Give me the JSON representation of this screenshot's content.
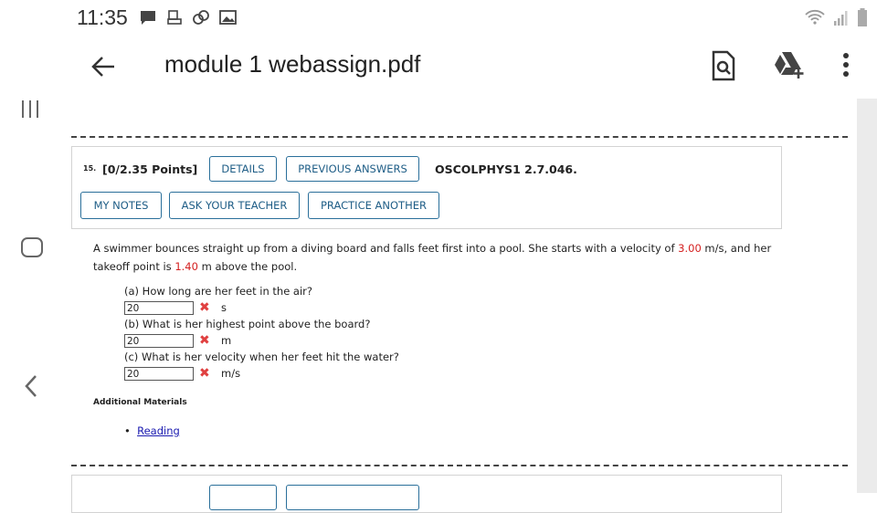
{
  "status_bar": {
    "time": "11:35"
  },
  "app_bar": {
    "title": "module 1 webassign.pdf",
    "icons": [
      "back-arrow-icon",
      "search-in-document-icon",
      "drive-add-icon",
      "more-vert-icon"
    ]
  },
  "question": {
    "number": "15.",
    "points": "[0/2.35 Points]",
    "buttons": {
      "details": "DETAILS",
      "previous_answers": "PREVIOUS ANSWERS",
      "my_notes": "MY NOTES",
      "ask_teacher": "ASK YOUR TEACHER",
      "practice_another": "PRACTICE ANOTHER"
    },
    "code": "OSCOLPHYS1 2.7.046.",
    "problem": {
      "p1": "A swimmer bounces straight up from a diving board and falls feet first into a pool. She starts with a velocity of ",
      "v": "3.00",
      "p2": " m/s, and her",
      "p3": "takeoff point is ",
      "h": "1.40",
      "p4": " m above the pool."
    },
    "parts": [
      {
        "question": "(a) How long are her feet in the air?",
        "answer": "20",
        "unit": "s"
      },
      {
        "question": "(b) What is her highest point above the board?",
        "answer": "20",
        "unit": "m"
      },
      {
        "question": "(c) What is her velocity when her feet hit the water?",
        "answer": "20",
        "unit": "m/s"
      }
    ],
    "mark": "✖",
    "additional_materials": "Additional Materials",
    "reading_link": "Reading"
  },
  "colors": {
    "accent": "#2a6f9a",
    "error": "#e04040",
    "highlight_value": "#d42020"
  }
}
